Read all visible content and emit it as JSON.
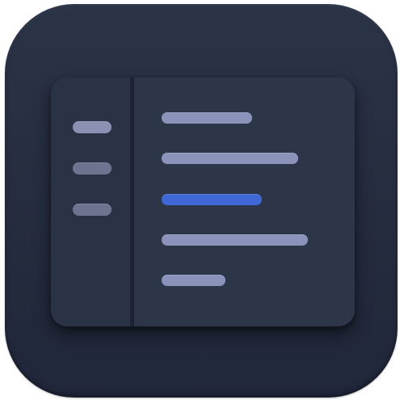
{
  "colors": {
    "tile_background": "#262d40",
    "window_background": "#2c3447",
    "sidebar_item_primary": "#8a91b2",
    "sidebar_item_secondary": "#6e7490",
    "list_line": "#8c93ba",
    "list_line_selected": "#3f68d6"
  },
  "sidebar": {
    "items": [
      {
        "icon": "line-icon",
        "state": "primary"
      },
      {
        "icon": "line-icon",
        "state": "secondary"
      },
      {
        "icon": "line-icon",
        "state": "secondary"
      }
    ]
  },
  "list": {
    "selected_index": 2,
    "item_count": 5
  }
}
